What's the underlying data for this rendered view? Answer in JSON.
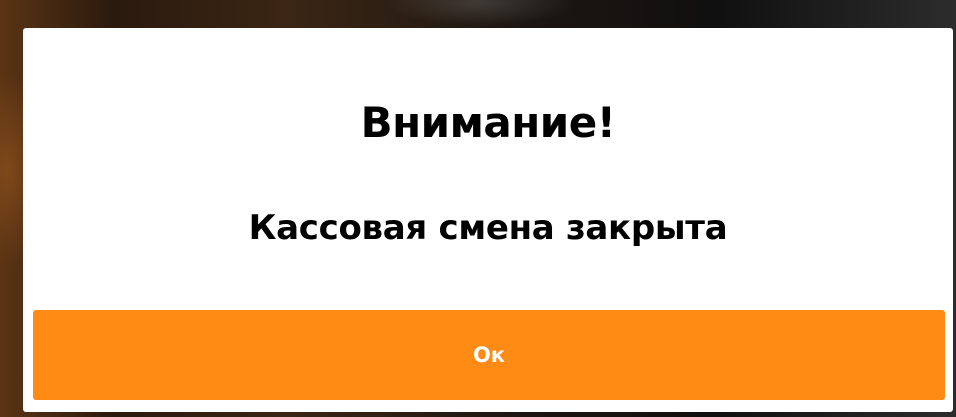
{
  "dialog": {
    "title": "Внимание!",
    "message": "Кассовая смена закрыта",
    "ok_label": "Ок"
  },
  "colors": {
    "accent": "#ff8a14",
    "dialog_background": "#ffffff",
    "text": "#000000",
    "button_text": "#ffffff"
  }
}
